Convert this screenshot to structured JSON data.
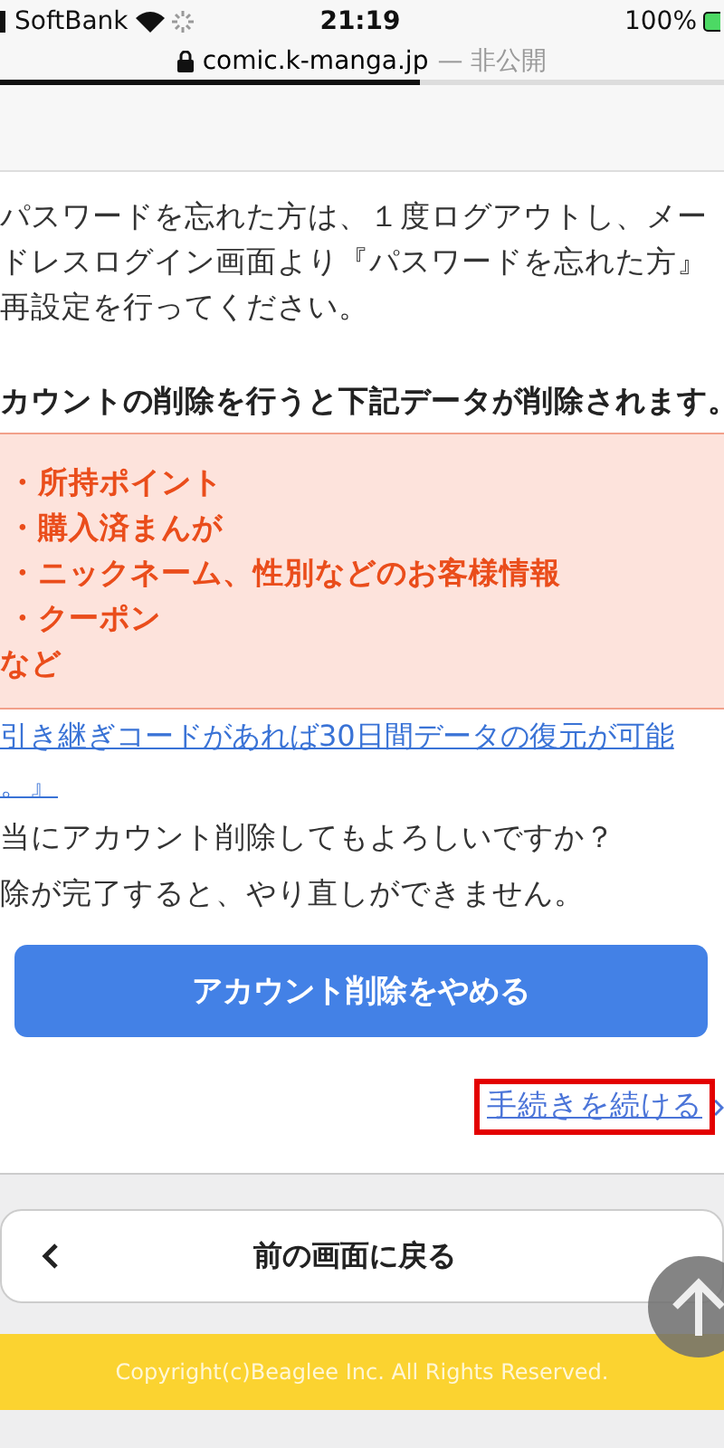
{
  "status_bar": {
    "carrier": "SoftBank",
    "time": "21:19",
    "battery": "100%"
  },
  "address_bar": {
    "domain": "comic.k-manga.jp",
    "privacy": "— 非公開",
    "load_progress": {
      "level": 0.58
    }
  },
  "notice": {
    "paragraph_lines": [
      "パスワードを忘れた方は、１度ログアウトし、メー",
      "ドレスログイン画面より『パスワードを忘れた方』",
      "再設定を行ってください。"
    ],
    "heading": "カウントの削除を行うと下記データが削除されます。",
    "deleted_items": [
      "・所持ポイント",
      "・購入済まんが",
      "・ニックネーム、性別などのお客様情報",
      "・クーポン",
      "など"
    ],
    "restore_link_lines": [
      "引き継ぎコードがあれば30日間データの復元が可能",
      "。』"
    ],
    "confirm_lines": [
      "当にアカウント削除してもよろしいですか？",
      "除が完了すると、やり直しができません。"
    ]
  },
  "cancel_button": {
    "label": "アカウント削除をやめる"
  },
  "continue_link": {
    "label": "手続きを続ける",
    "highlighted": true
  },
  "back_button": {
    "label": "前の画面に戻る"
  },
  "footer": {
    "copyright": "Copyright(c)Beaglee Inc. All Rights Reserved."
  }
}
